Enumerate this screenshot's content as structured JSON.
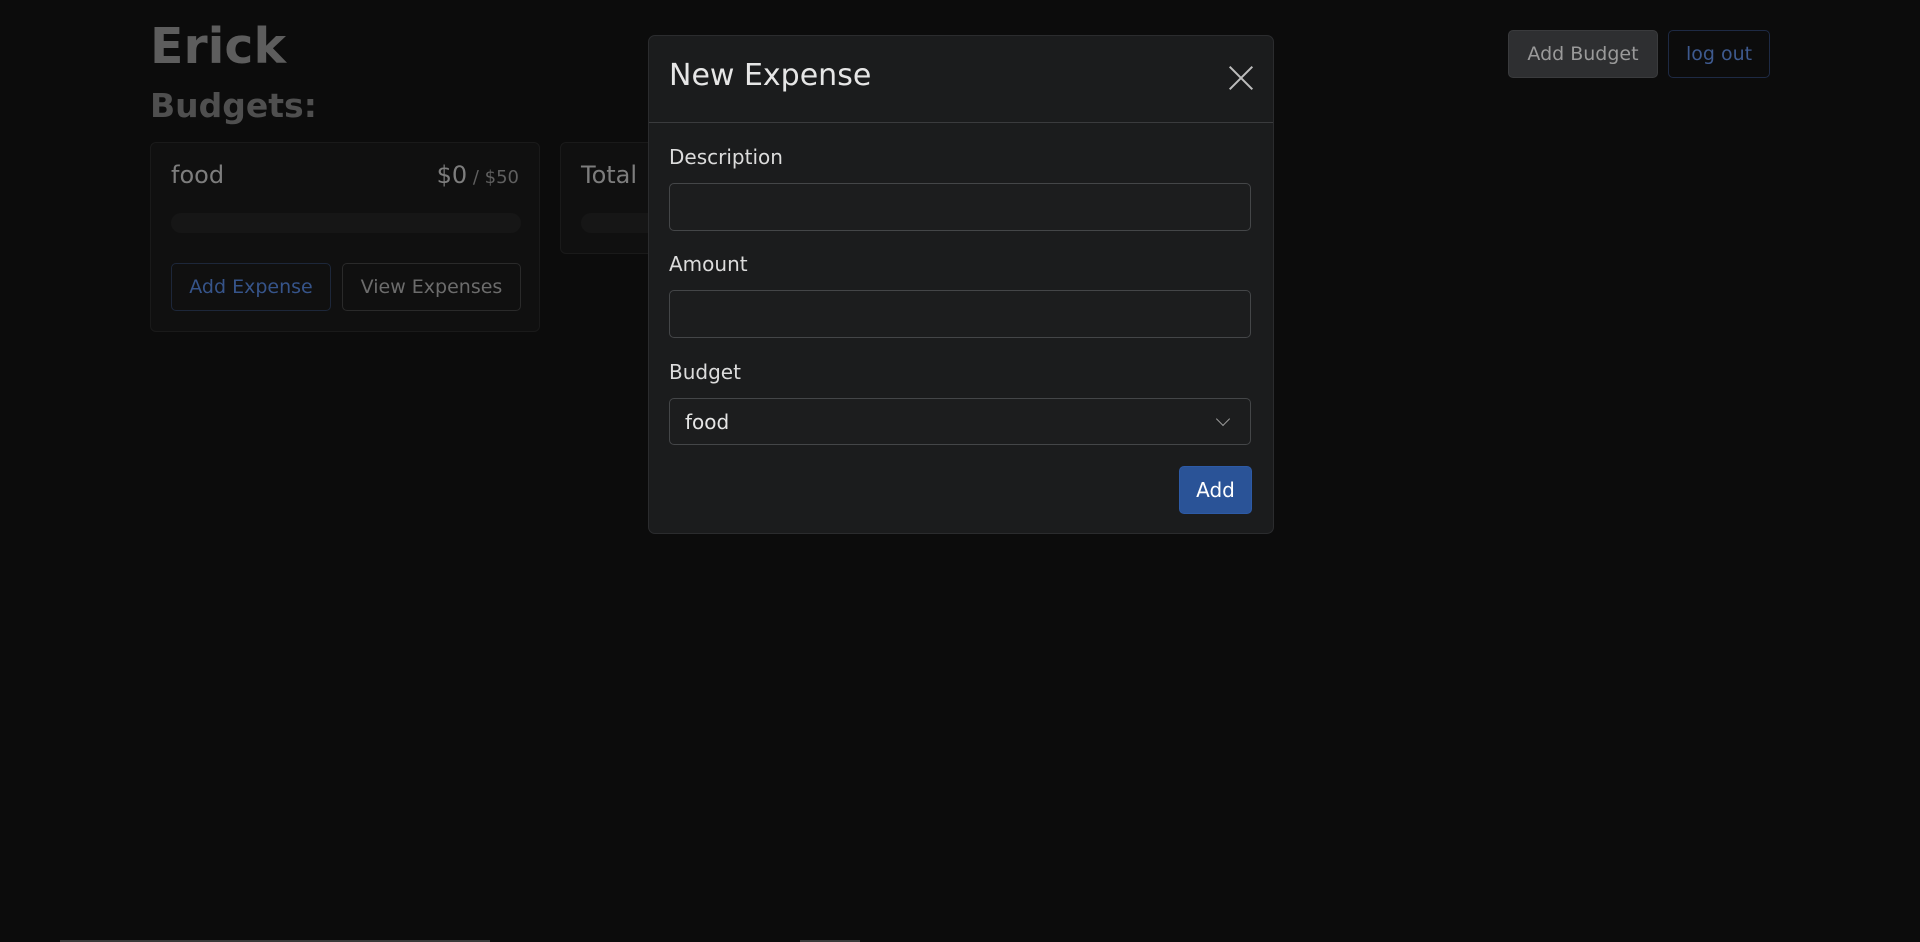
{
  "header": {
    "user_name": "Erick",
    "budgets_heading": "Budgets:",
    "add_budget_label": "Add Budget",
    "logout_label": "log out"
  },
  "budget_cards": [
    {
      "name": "food",
      "spent": "$0",
      "separator": " / ",
      "max": "$50",
      "progress": 0,
      "add_expense_label": "Add Expense",
      "view_expenses_label": "View Expenses"
    },
    {
      "name": "Total",
      "progress": 0
    }
  ],
  "modal": {
    "title": "New Expense",
    "description_label": "Description",
    "description_value": "",
    "amount_label": "Amount",
    "amount_value": "",
    "budget_label": "Budget",
    "budget_selected": "food",
    "submit_label": "Add"
  },
  "colors": {
    "accent": "#2a5397",
    "background": "#0c0c0c",
    "modal_bg": "#1b1c1d"
  }
}
